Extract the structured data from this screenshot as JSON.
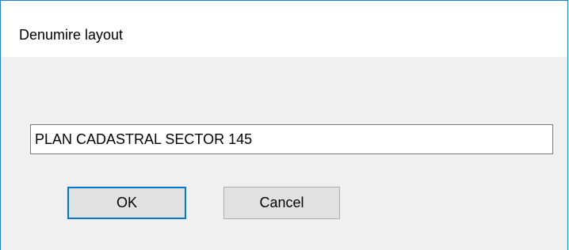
{
  "dialog": {
    "title": "Denumire layout",
    "input_value": "PLAN CADASTRAL SECTOR 145",
    "ok_label": "OK",
    "cancel_label": "Cancel"
  },
  "colors": {
    "window_border": "#1883d7",
    "content_bg": "#f0f0f0",
    "button_bg": "#e1e1e1",
    "default_button_border": "#0078d7"
  }
}
